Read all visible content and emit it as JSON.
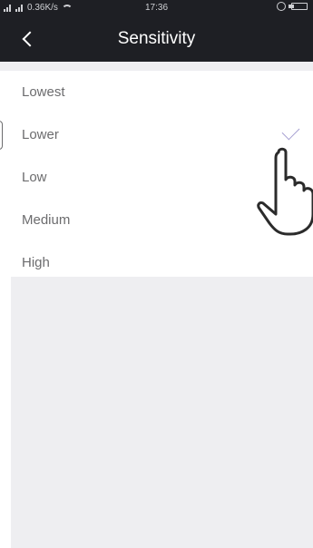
{
  "status_bar": {
    "network_speed": "0.36K/s",
    "time": "17:36"
  },
  "header": {
    "title": "Sensitivity"
  },
  "options": [
    {
      "label": "Lowest",
      "selected": false
    },
    {
      "label": "Lower",
      "selected": true
    },
    {
      "label": "Low",
      "selected": false
    },
    {
      "label": "Medium",
      "selected": false
    },
    {
      "label": "High",
      "selected": false
    }
  ],
  "colors": {
    "header_bg": "#1e1f24",
    "check": "#a6a0d2",
    "separator_bg": "#eeeef1"
  }
}
